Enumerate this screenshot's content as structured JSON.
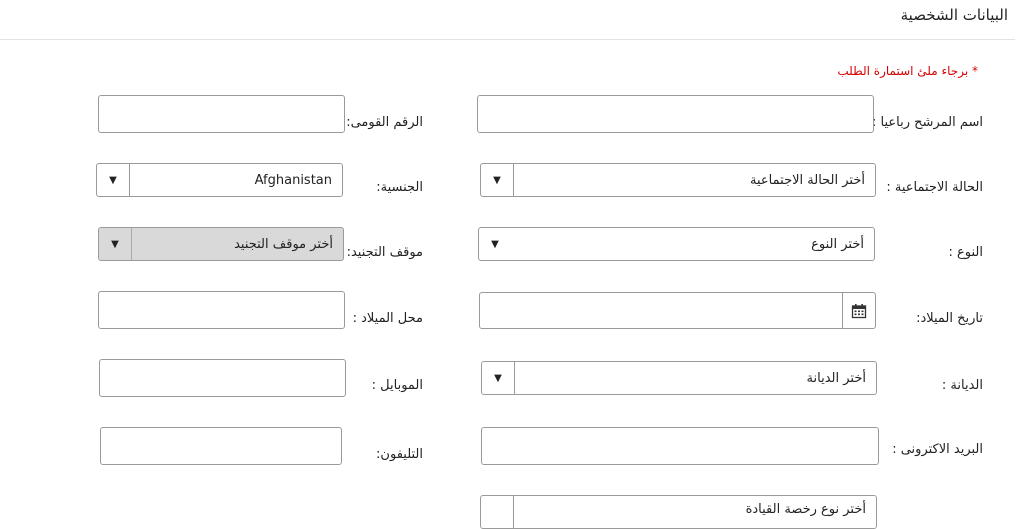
{
  "page": {
    "title": "البيانات الشخصية",
    "required_note": "* برجاء ملئ استمارة الطلب"
  },
  "labels": {
    "full_name": "اسم المرشح رباعيا :",
    "national_id": "الرقم القومى:",
    "marital_status": "الحالة الاجتماعية :",
    "nationality": "الجنسية:",
    "gender": "النوع :",
    "military_status": "موقف التجنيد:",
    "birth_date": "تاريخ الميلاد:",
    "birth_place": "محل الميلاد :",
    "religion": "الديانة :",
    "mobile": "الموبايل :",
    "email": "البريد الاكترونى :",
    "phone": "التليفون:"
  },
  "selects": {
    "marital_status": "أختر الحالة الاجتماعية",
    "nationality": "Afghanistan",
    "gender": "أختر النوع",
    "military_status": "أختر موقف التجنيد",
    "religion": "أختر الديانة",
    "partial_next": "أختر نوع رخصة القيادة"
  },
  "icons": {
    "caret": "▼",
    "calendar": "calendar-icon"
  }
}
